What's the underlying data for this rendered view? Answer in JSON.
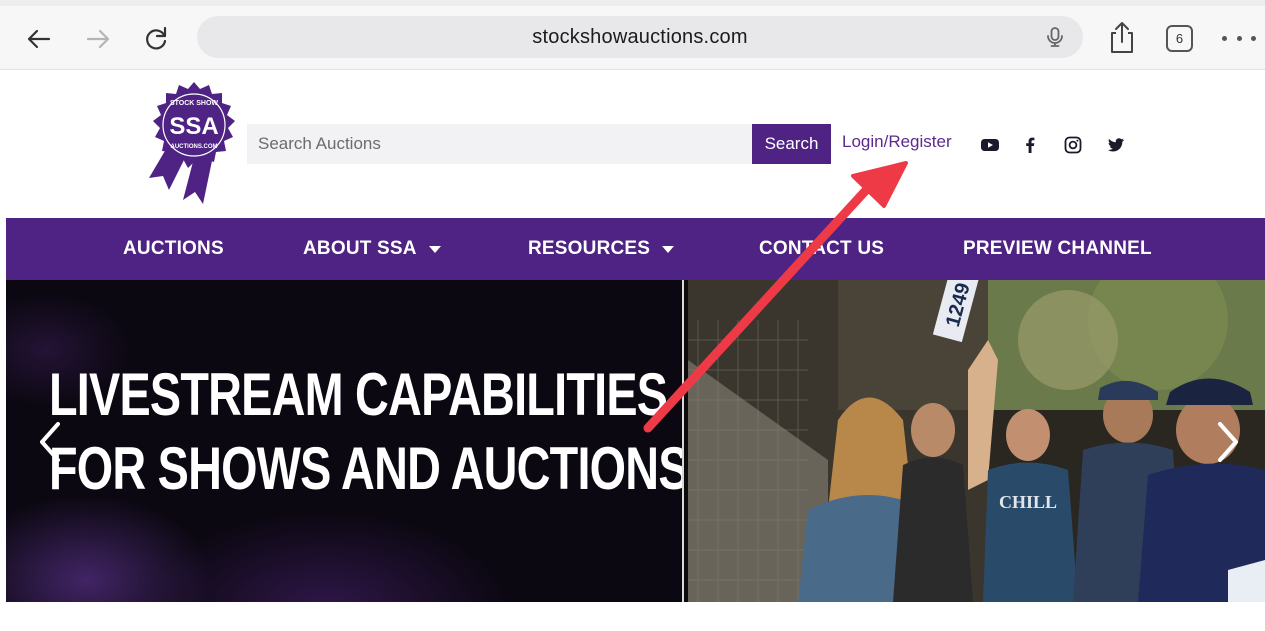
{
  "browser": {
    "url": "stockshowauctions.com",
    "tab_count": "6"
  },
  "header": {
    "logo_text": "SSA",
    "logo_ring_top": "STOCK SHOW",
    "logo_ring_bottom": "AUCTIONS.COM",
    "search_placeholder": "Search Auctions",
    "search_button": "Search",
    "login_link": "Login/Register"
  },
  "nav": {
    "items": [
      {
        "label": "AUCTIONS"
      },
      {
        "label": "ABOUT SSA"
      },
      {
        "label": "RESOURCES"
      },
      {
        "label": "CONTACT US"
      },
      {
        "label": "PREVIEW CHANNEL"
      }
    ]
  },
  "hero": {
    "headline_line1": "LIVESTREAM CAPABILITIES",
    "headline_line2": "FOR SHOWS AND AUCTIONS",
    "photo_sign": "1249",
    "photo_shirt": "CHILL"
  },
  "colors": {
    "brand_purple": "#4f2384",
    "annotation_red": "#ee3a47"
  }
}
